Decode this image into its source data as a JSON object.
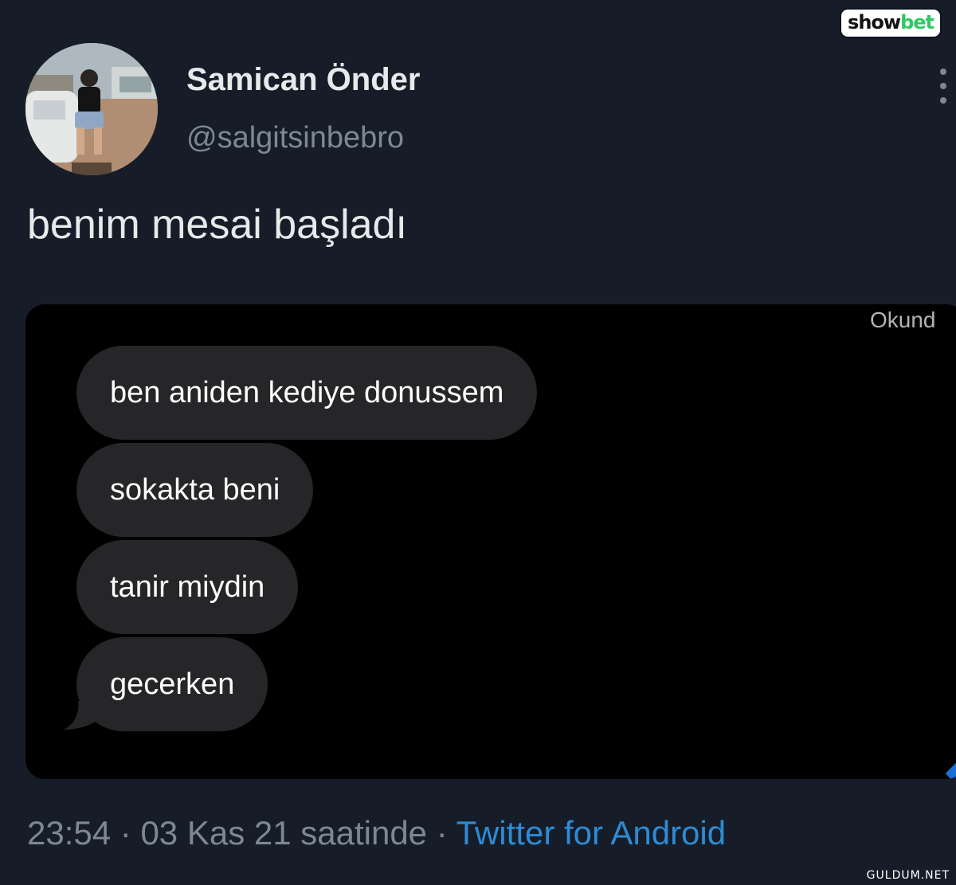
{
  "watermarks": {
    "top_part1": "show",
    "top_part2": "bet",
    "top_colors": {
      "part1": "#111111",
      "part2": "#2ec866"
    },
    "bottom": "GULDUM.NET"
  },
  "tweet": {
    "author": {
      "display_name": "Samican Önder",
      "handle": "@salgitsinbebro"
    },
    "text": "benim mesai başladı",
    "more_icon": "more-vertical-icon",
    "media": {
      "read_receipt": "Okund",
      "messages": [
        "ben aniden kediye donussem",
        "sokakta beni",
        "tanir miydin",
        "gecerken"
      ]
    },
    "meta": {
      "time": "23:54",
      "separator": " · ",
      "date": "03 Kas 21 saatinde",
      "separator2": " · ",
      "source": "Twitter for Android"
    }
  },
  "colors": {
    "background": "#161d28",
    "text_primary": "#e7e9ea",
    "text_secondary": "#7d8893",
    "link": "#2e8bd6",
    "bubble": "#262628"
  }
}
